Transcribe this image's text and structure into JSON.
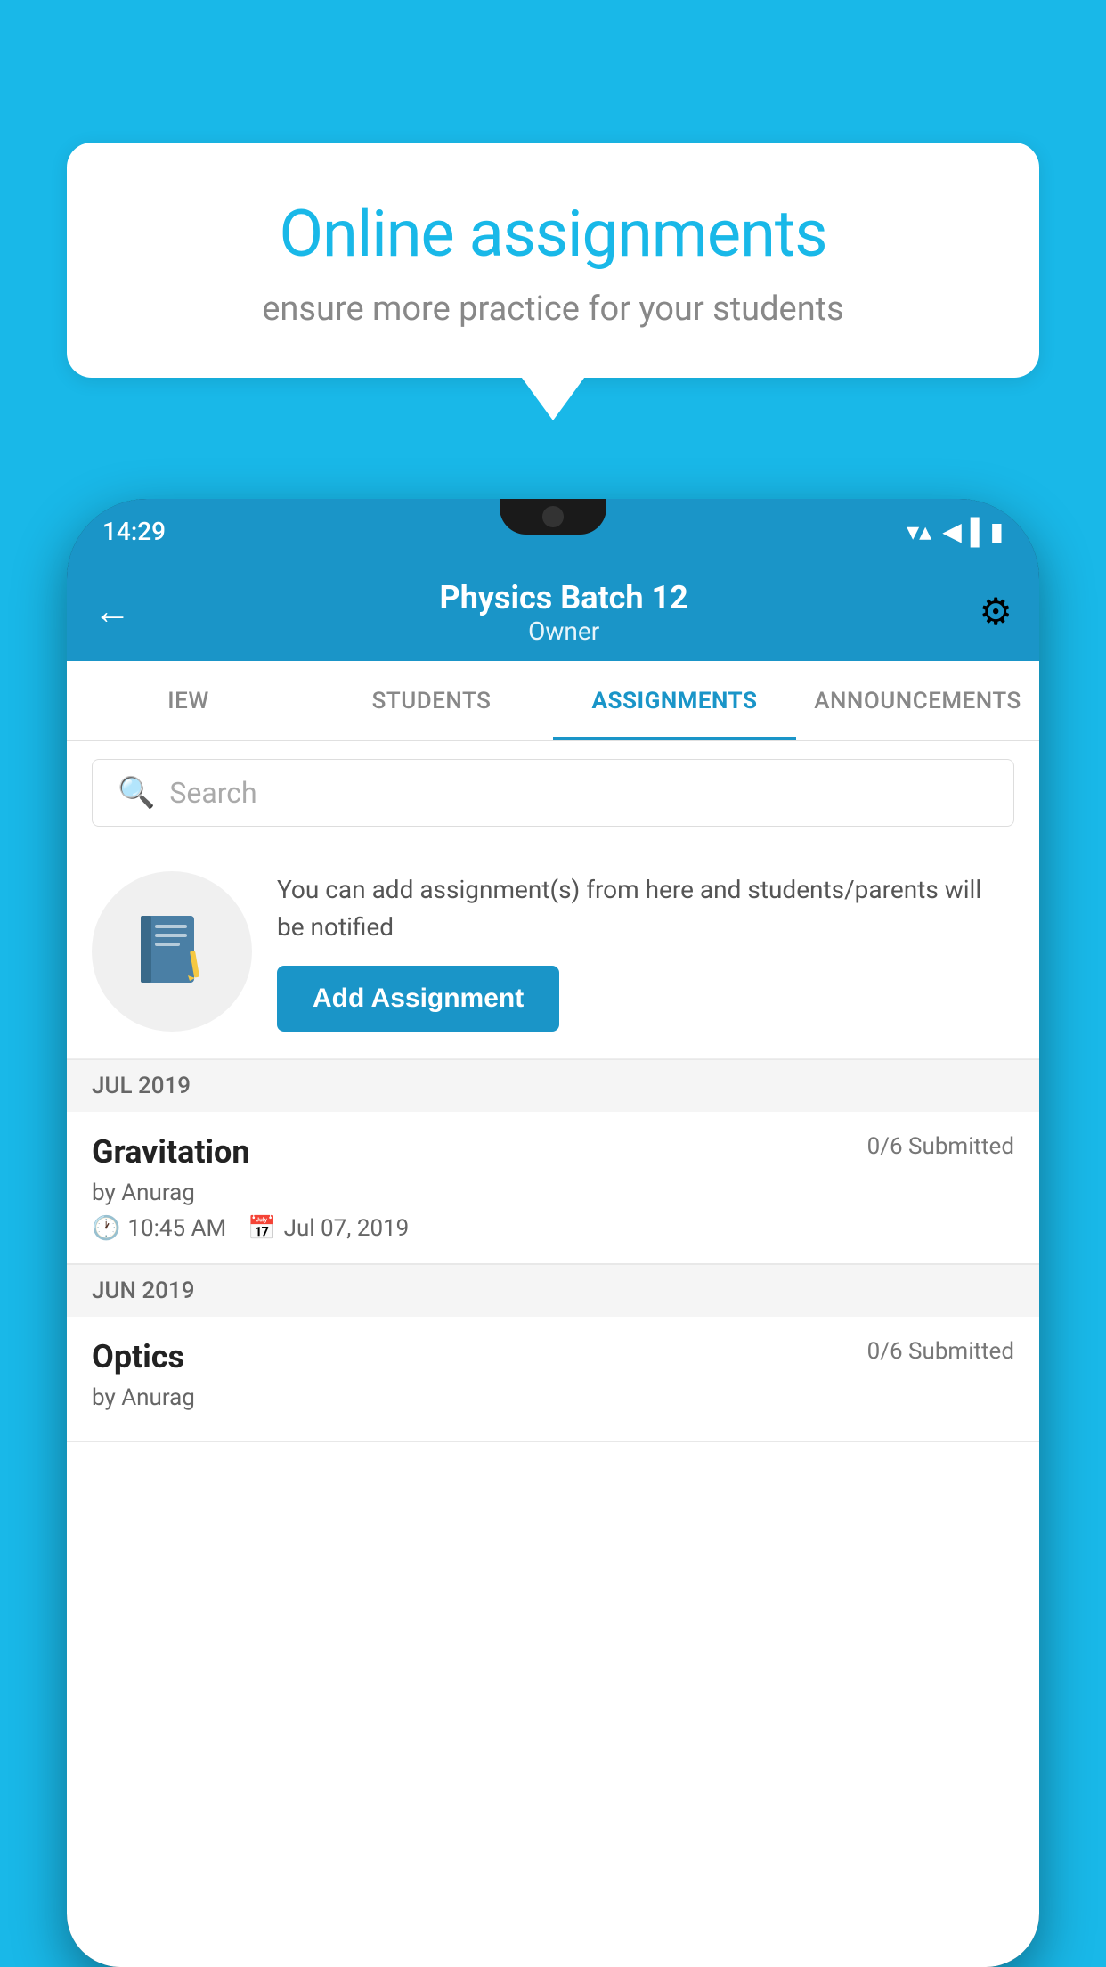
{
  "background_color": "#19b8e8",
  "speech_bubble": {
    "title": "Online assignments",
    "subtitle": "ensure more practice for your students"
  },
  "phone": {
    "status_bar": {
      "time": "14:29",
      "icons": [
        "wifi",
        "signal",
        "battery"
      ]
    },
    "app_bar": {
      "batch_title": "Physics Batch 12",
      "batch_subtitle": "Owner",
      "back_label": "←",
      "settings_label": "⚙"
    },
    "tabs": [
      {
        "label": "IEW",
        "active": false
      },
      {
        "label": "STUDENTS",
        "active": false
      },
      {
        "label": "ASSIGNMENTS",
        "active": true
      },
      {
        "label": "ANNOUNCEMENTS",
        "active": false
      }
    ],
    "search": {
      "placeholder": "Search"
    },
    "promo": {
      "description": "You can add assignment(s) from here and students/parents will be notified",
      "button_label": "Add Assignment"
    },
    "sections": [
      {
        "header": "JUL 2019",
        "assignments": [
          {
            "name": "Gravitation",
            "submitted": "0/6 Submitted",
            "by": "by Anurag",
            "time": "10:45 AM",
            "date": "Jul 07, 2019"
          }
        ]
      },
      {
        "header": "JUN 2019",
        "assignments": [
          {
            "name": "Optics",
            "submitted": "0/6 Submitted",
            "by": "by Anurag",
            "time": "",
            "date": ""
          }
        ]
      }
    ]
  }
}
